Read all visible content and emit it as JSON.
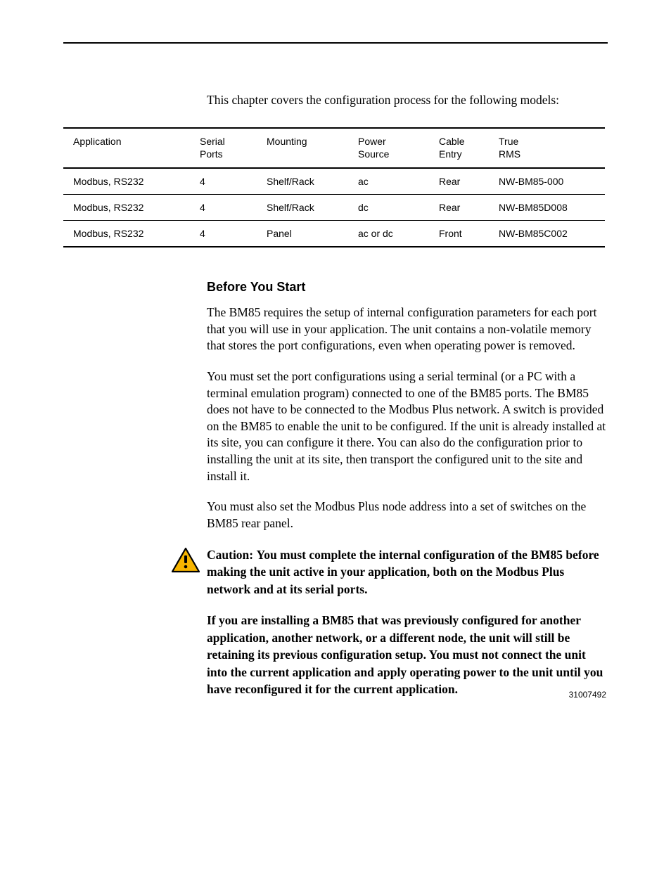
{
  "intro": "This chapter covers the configuration process for the following models:",
  "table": {
    "headers": [
      "Application",
      "Serial\nPorts",
      "Mounting",
      "Power\nSource",
      "Cable\nEntry",
      "True\nRMS"
    ],
    "rows": [
      [
        "Modbus, RS232",
        "4",
        "Shelf/Rack",
        "ac",
        "Rear",
        "NW-BM85-000"
      ],
      [
        "Modbus, RS232",
        "4",
        "Shelf/Rack",
        "dc",
        "Rear",
        "NW-BM85D008"
      ],
      [
        "Modbus, RS232",
        "4",
        "Panel",
        "ac or dc",
        "Front",
        "NW-BM85C002"
      ]
    ]
  },
  "sectionHead": "Before You Start",
  "p1": "The BM85 requires the setup of internal configuration parameters for each port that you will use in your application.  The unit contains a non-volatile memory that stores the port configurations, even when operating power is removed.",
  "p2": "You must set the port configurations using a serial terminal (or a PC with a terminal emulation program) connected to one of the BM85 ports. The BM85 does not have to be connected to the Modbus Plus network. A switch is provided on the BM85 to enable the unit to be configured. If the unit is already installed at its site, you can configure it there. You can also do the configuration prior to installing the unit at its site, then transport the configured unit to the site and install it.",
  "p3": "You must also set the Modbus Plus node address into a set of switches on the BM85 rear panel.",
  "caution": {
    "label": "Caution: ",
    "text": "You must complete the internal configuration of the BM85 before making the unit active in your application, both on the Modbus Plus network and at its serial ports."
  },
  "p4": "If you are installing a BM85 that was previously configured for another application, another network, or a different node, the unit will still be retaining its previous configuration setup. You must not connect the unit into the current application and apply operating power to the unit until you have reconfigured it for the current application.",
  "docnum": "31007492",
  "icons": {
    "warning": "warning-triangle"
  }
}
